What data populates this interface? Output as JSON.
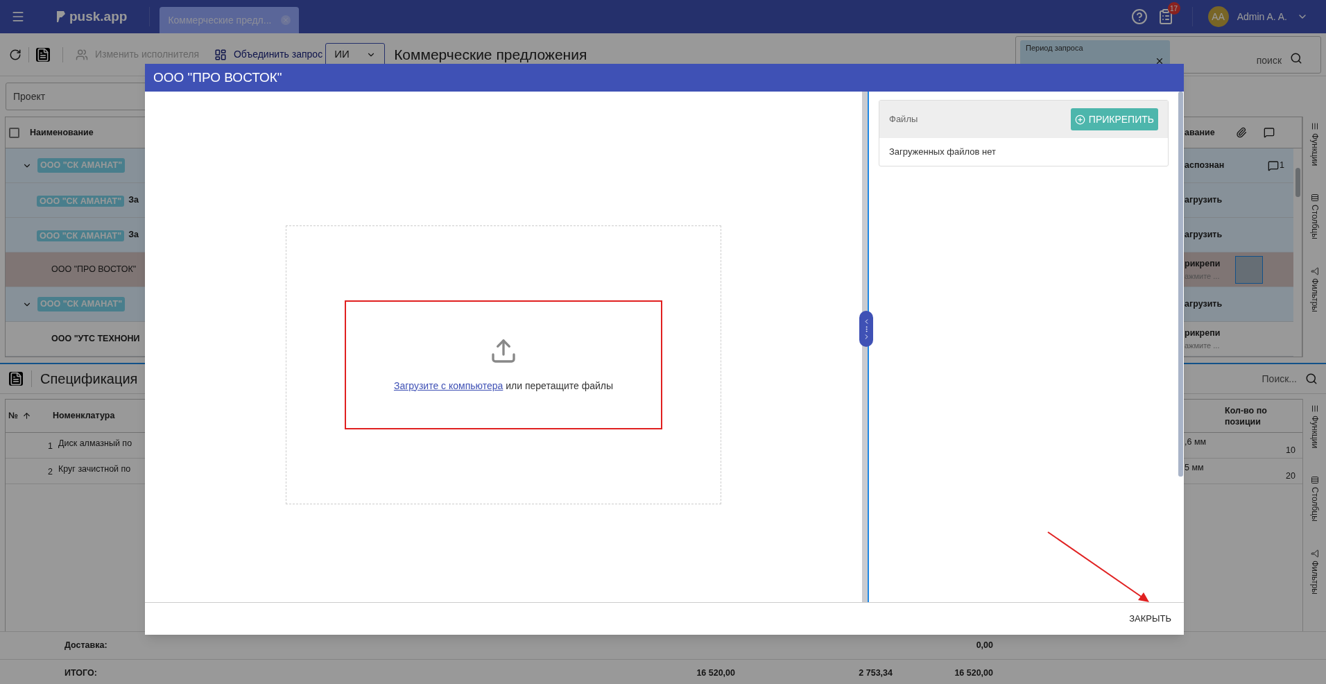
{
  "header": {
    "app_name": "pusk.app",
    "tab": {
      "label": "Коммерческие предл..."
    },
    "notification_count": "17",
    "user": {
      "initials": "AA",
      "name": "Admin A. A."
    }
  },
  "toolbar": {
    "change_executor": {
      "label": "Изменить исполнителя",
      "disabled": true
    },
    "merge": {
      "label": "Объединить запрос"
    },
    "mode_select": {
      "value": "ИИ"
    },
    "title": "Коммерческие предложения"
  },
  "period_filter": {
    "label": "Период запроса"
  },
  "search": {
    "placeholder": "поиск"
  },
  "project_filter": {
    "placeholder": "Проект"
  },
  "offers_table": {
    "select_all": {
      "checked": false
    },
    "columns": {
      "left": "Наименование",
      "right": "авание"
    },
    "rows": [
      {
        "kind": "group",
        "tag": "ООО \"СК АМАНАТ\"",
        "expanded": true,
        "highlighted": true,
        "selected": false,
        "right_text": "аспознан",
        "comment_count": "1"
      },
      {
        "kind": "child",
        "tag": "ООО \"СК АМАНАТ\"",
        "suffix": "За",
        "highlighted": true,
        "selected": false,
        "right_text": "агрузить"
      },
      {
        "kind": "child",
        "tag": "ООО \"СК АМАНАТ\"",
        "suffix": "За",
        "highlighted": true,
        "selected": false,
        "right_text": "агрузить"
      },
      {
        "kind": "plain",
        "name": "ООО \"ПРО ВОСТОК\"",
        "bold": false,
        "highlighted": true,
        "selected": true,
        "right_text": "рикрепи",
        "right_subtext": "ажмите ..."
      },
      {
        "kind": "group",
        "tag": "ООО \"СК АМАНАТ\"",
        "expanded": true,
        "highlighted": true,
        "selected": false,
        "right_text": "агрузить"
      },
      {
        "kind": "plain",
        "name": "ООО \"УТС ТЕХНОНИ",
        "bold": true,
        "highlighted": false,
        "selected": false,
        "right_text": "рикрепи",
        "right_subtext": "ажмите ..."
      }
    ]
  },
  "side_tabs": [
    "Функции",
    "Столбцы",
    "Фильтры"
  ],
  "spec": {
    "title": "Спецификация",
    "search_placeholder": "Поиск...",
    "columns": {
      "number": "№",
      "name": "Номенклатура",
      "quantity": "Кол-во по позиции"
    },
    "rows": [
      {
        "number": "1",
        "name": "Диск алмазный по",
        "size": ",6 мм",
        "quantity": "10"
      },
      {
        "number": "2",
        "name": "Круг зачистной по",
        "size": "5 мм",
        "quantity": "20"
      }
    ]
  },
  "side_tabs_lower": [
    "Функции",
    "Столбцы",
    "Фильтры"
  ],
  "totals": [
    {
      "label": "Доставка:",
      "column_3": "0,00"
    },
    {
      "label": "ИТОГО:",
      "column_1": "16 520,00",
      "column_2": "2 753,34",
      "column_3": "16 520,00"
    }
  ],
  "modal": {
    "title": "ООО \"ПРО ВОСТОК\"",
    "dropzone": {
      "link": "Загрузите с компьютера",
      "text": "или перетащите файлы"
    },
    "files": {
      "title": "Файлы",
      "attach_button": "ПРИКРЕПИТЬ",
      "empty_text": "Загруженных файлов нет"
    },
    "close_button": "ЗАКРЫТЬ"
  }
}
